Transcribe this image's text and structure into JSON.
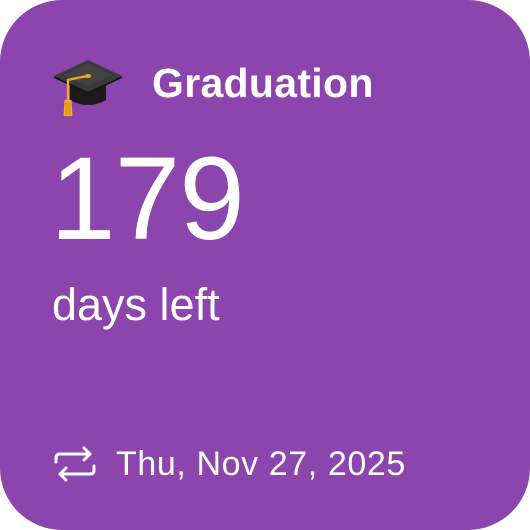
{
  "widget": {
    "background_color": "#8b45ac",
    "icon": "graduation-cap-icon",
    "title": "Graduation",
    "count": "179",
    "unit_label": "days left",
    "repeat_icon": "repeat-icon",
    "date": "Thu, Nov 27, 2025"
  }
}
